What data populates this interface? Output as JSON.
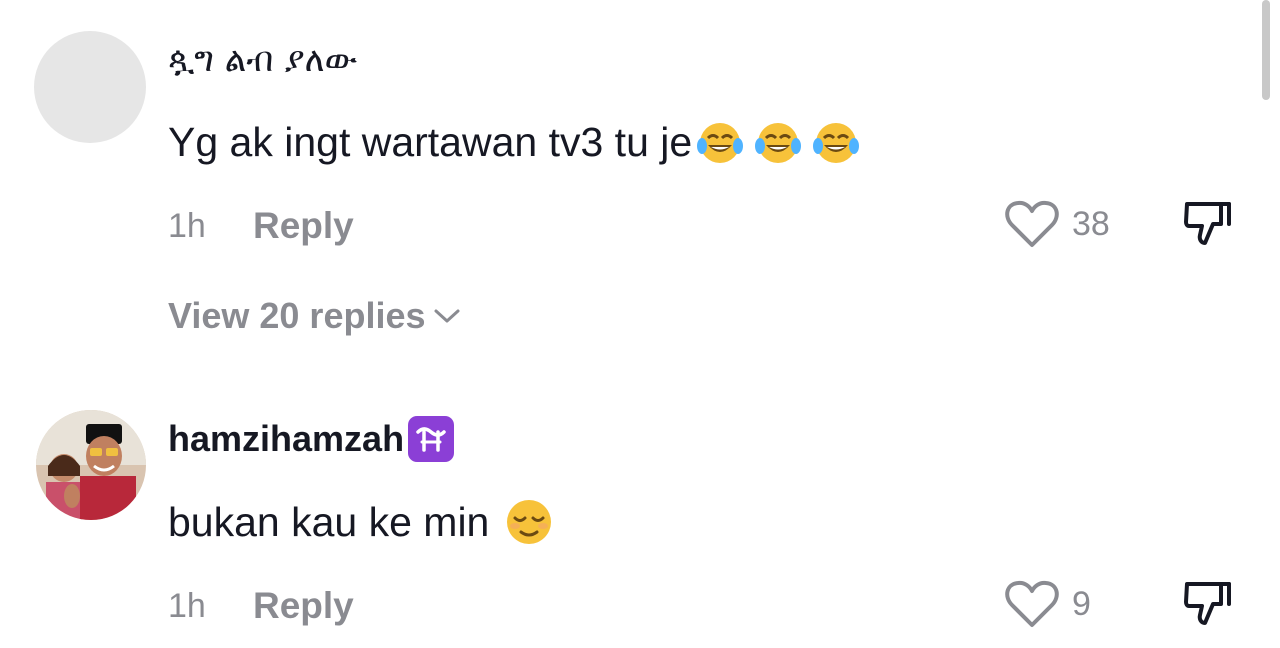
{
  "comments": [
    {
      "username": "ጷግ ልብ ያለው",
      "text": "Yg ak ingt wartawan tv3 tu je",
      "emojis": [
        "face-with-tears-of-joy",
        "face-with-tears-of-joy",
        "face-with-tears-of-joy"
      ],
      "time": "1h",
      "reply_label": "Reply",
      "likes": "38",
      "view_replies": "View 20 replies"
    },
    {
      "username": "hamzihamzah",
      "badge": "ophiuchus-badge",
      "text": "bukan kau ke min",
      "emojis": [
        "relieved-face"
      ],
      "time": "1h",
      "reply_label": "Reply",
      "likes": "9"
    }
  ],
  "colors": {
    "text": "#161823",
    "muted": "#8a8b91",
    "badge": "#8b3fd6",
    "emoji": "#f7c23a"
  }
}
